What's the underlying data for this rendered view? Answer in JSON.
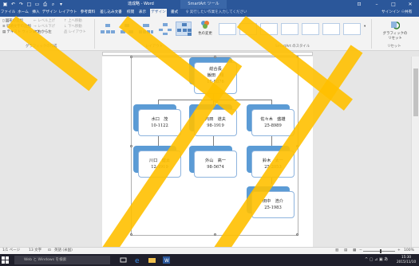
{
  "titlebar": {
    "title": "達成略 - Word",
    "context_tab": "SmartArt ツール",
    "quick_access": [
      "save-icon",
      "undo-icon",
      "redo-icon",
      "new-icon",
      "open-icon",
      "print-icon",
      "preview-icon",
      "customize-icon"
    ]
  },
  "tabs": [
    {
      "label": "ファイル"
    },
    {
      "label": "ホーム"
    },
    {
      "label": "挿入"
    },
    {
      "label": "デザイン"
    },
    {
      "label": "レイアウト"
    },
    {
      "label": "参考資料"
    },
    {
      "label": "差し込み文書"
    },
    {
      "label": "校閲"
    },
    {
      "label": "表示"
    },
    {
      "label": "デザイン"
    },
    {
      "label": "書式"
    }
  ],
  "tell_me": "実行したい作業を入力してください",
  "signin": "サインイン",
  "share": "共有",
  "ribbon": {
    "create_graphic": {
      "items": [
        "図形の追加",
        "行頭文字の追加",
        "テキスト ウィンドウ",
        "レベル上げ",
        "レベル下げ",
        "右から左",
        "上へ移動",
        "下へ移動",
        "レイアウト"
      ],
      "label": "グラフィックの作成"
    },
    "layouts_label": "レイアウト",
    "change_colors": "色の変更",
    "styles_label": "SmartArt のスタイル",
    "reset_graphic": "グラフィックのリセット",
    "reset_label": "リセット"
  },
  "org_chart": {
    "top": {
      "line1": "総合長",
      "line2": "飯田　翔",
      "line3": "11-9876"
    },
    "level2": [
      {
        "line1": "水口　茂",
        "line2": "10-1122"
      },
      {
        "line1": "内田　道夫",
        "line2": "98-1919"
      },
      {
        "line1": "佐々木　盛雄",
        "line2": "25-8989"
      }
    ],
    "level3": [
      {
        "line1": "川口　健太",
        "line2": "12-1919"
      },
      {
        "line1": "外山　高一",
        "line2": "98-5674"
      },
      {
        "line1": "鈴木　太一",
        "line2": "25-2053"
      }
    ],
    "level4": [
      {
        "line1": "田中　浩介",
        "line2": "25-1983"
      }
    ]
  },
  "status": {
    "page": "1/1 ページ",
    "words": "13 文字",
    "lang": "英語 (米国)",
    "zoom": "100%"
  },
  "taskbar": {
    "search_placeholder": "Web と Windows を検索",
    "time": "15:30",
    "date": "2015/11/10"
  },
  "colors": {
    "word_blue": "#2b579a",
    "node_fill": "#5b9bd5",
    "watermark": "#ffc000"
  }
}
